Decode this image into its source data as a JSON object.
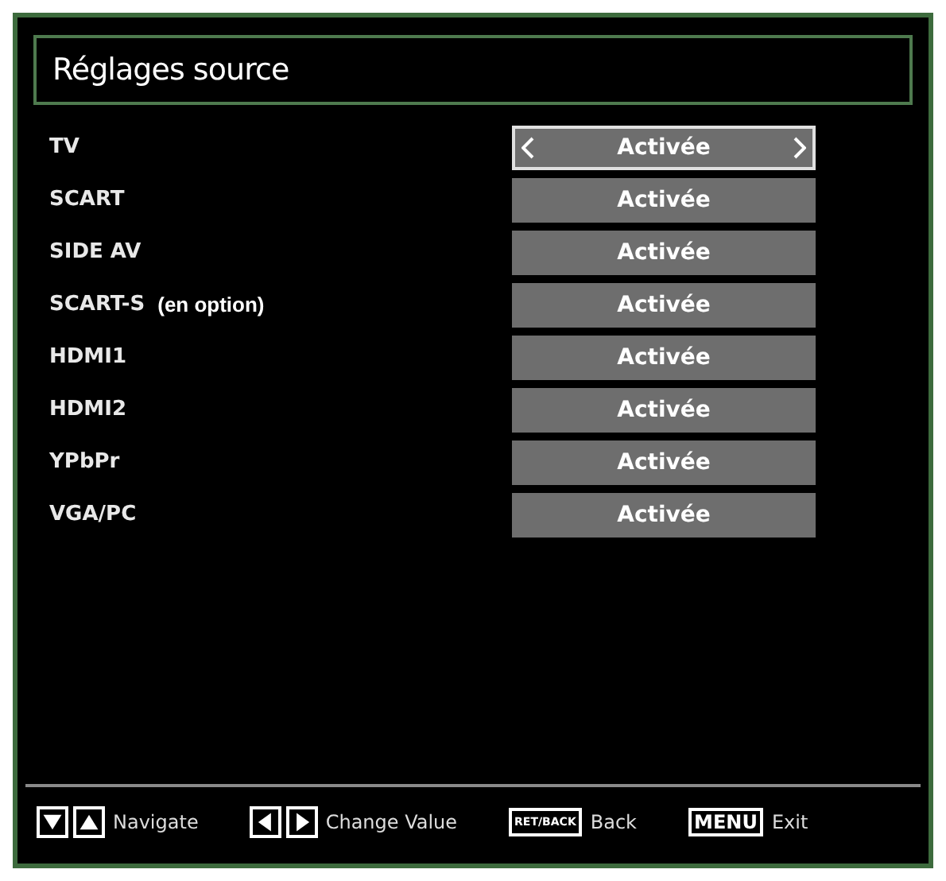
{
  "title": "Réglages source",
  "rows": [
    {
      "label": "TV",
      "value": "Activée",
      "selected": true
    },
    {
      "label": "SCART",
      "value": "Activée",
      "selected": false
    },
    {
      "label": "SIDE AV",
      "value": "Activée",
      "selected": false
    },
    {
      "label": "SCART-S",
      "note": "(en option)",
      "value": "Activée",
      "selected": false
    },
    {
      "label": "HDMI1",
      "value": "Activée",
      "selected": false
    },
    {
      "label": "HDMI2",
      "value": "Activée",
      "selected": false
    },
    {
      "label": "YPbPr",
      "value": "Activée",
      "selected": false
    },
    {
      "label": "VGA/PC",
      "value": "Activée",
      "selected": false
    }
  ],
  "legend": [
    {
      "keys": [
        {
          "kind": "down"
        },
        {
          "kind": "up"
        }
      ],
      "label": "Navigate"
    },
    {
      "keys": [
        {
          "kind": "left"
        },
        {
          "kind": "right"
        }
      ],
      "label": "Change Value"
    },
    {
      "keys": [
        {
          "kind": "text",
          "text": "RET/BACK"
        }
      ],
      "label": "Back"
    },
    {
      "keys": [
        {
          "kind": "text",
          "text": "MENU"
        }
      ],
      "label": "Exit"
    }
  ]
}
